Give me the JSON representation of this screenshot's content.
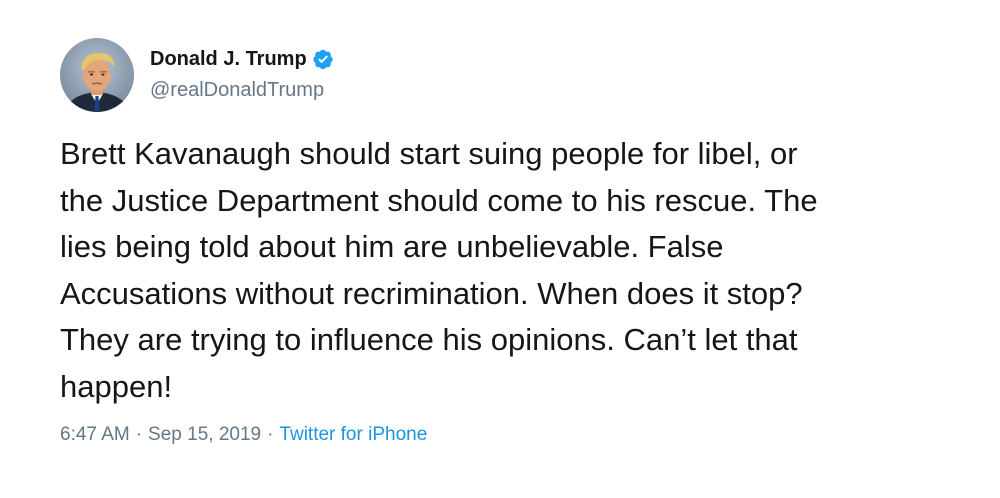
{
  "author": {
    "display_name": "Donald J. Trump",
    "handle": "@realDonaldTrump",
    "verified": true,
    "verified_icon": "verified-badge-icon",
    "verified_color": "#1da1f2"
  },
  "tweet": {
    "text_lines": [
      "Brett Kavanaugh should start suing people for libel, or",
      "the Justice Department should come to his rescue. The",
      "lies being told about him are unbelievable. False",
      "Accusations without recrimination. When does it stop?",
      "They are trying to influence his opinions. Can’t let that",
      "happen!"
    ]
  },
  "meta": {
    "time": "6:47 AM",
    "separator": "·",
    "date": "Sep 15, 2019",
    "source": "Twitter for iPhone",
    "source_color": "#1b95e0",
    "meta_color": "#657786"
  }
}
